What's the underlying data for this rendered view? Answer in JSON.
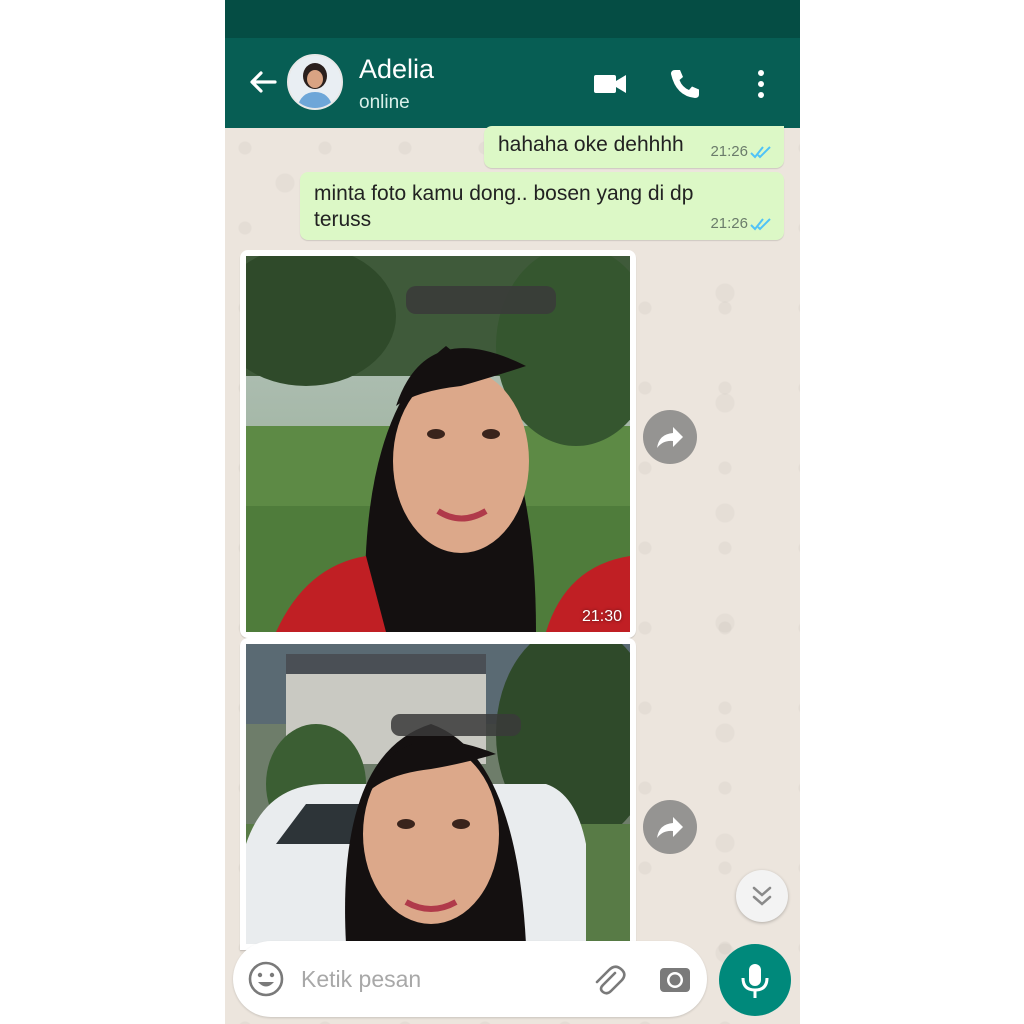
{
  "header": {
    "contact_name": "Adelia",
    "status": "online"
  },
  "messages": [
    {
      "type": "text",
      "direction": "out",
      "text": "hahaha oke dehhhh",
      "time": "21:26",
      "read": true
    },
    {
      "type": "text",
      "direction": "out",
      "text": "minta foto kamu dong.. bosen yang di dp teruss",
      "time": "21:26",
      "read": true
    },
    {
      "type": "image",
      "direction": "in",
      "time": "21:30",
      "description_icon": "photo"
    },
    {
      "type": "image",
      "direction": "in",
      "time": "",
      "description_icon": "photo"
    }
  ],
  "composer": {
    "placeholder": "Ketik pesan"
  },
  "colors": {
    "header": "#075e54",
    "statusbar": "#054d44",
    "outgoing_bubble": "#dcf8c6",
    "read_ticks": "#4fc3f7",
    "mic_button": "#00897b"
  },
  "icons": [
    "back-arrow-icon",
    "video-call-icon",
    "phone-icon",
    "more-vert-icon",
    "forward-icon",
    "chevron-double-down-icon",
    "emoji-icon",
    "attach-icon",
    "camera-icon",
    "mic-icon"
  ]
}
